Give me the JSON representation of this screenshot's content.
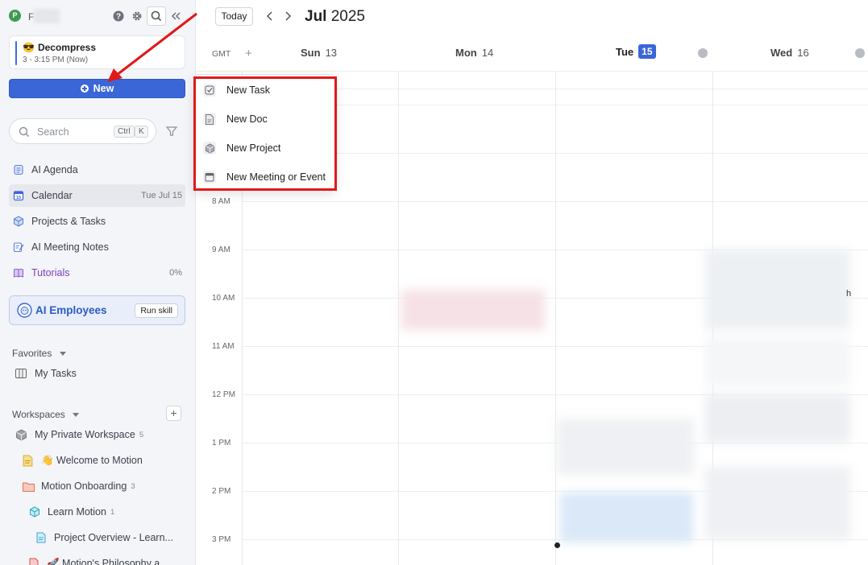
{
  "sidebar": {
    "workspace_initial": "P",
    "workspace_name": "F",
    "current_event": {
      "emoji": "😎",
      "title": "Decompress",
      "time": "3 - 3:15 PM (Now)"
    },
    "new_button_label": "New",
    "search": {
      "placeholder": "Search",
      "kbd1": "Ctrl",
      "kbd2": "K"
    },
    "nav": [
      {
        "label": "AI Agenda",
        "meta": "",
        "icon": "document-stack-icon"
      },
      {
        "label": "Calendar",
        "meta": "Tue Jul 15",
        "icon": "calendar-icon"
      },
      {
        "label": "Projects & Tasks",
        "meta": "",
        "icon": "cube-icon"
      },
      {
        "label": "AI Meeting Notes",
        "meta": "",
        "icon": "notes-icon"
      },
      {
        "label": "Tutorials",
        "meta": "0%",
        "icon": "book-icon"
      }
    ],
    "ai_employees": {
      "label": "AI Employees",
      "run_skill": "Run skill"
    },
    "favorites": {
      "heading": "Favorites",
      "items": [
        {
          "label": "My Tasks"
        }
      ]
    },
    "workspaces": {
      "heading": "Workspaces",
      "items": [
        {
          "label": "My Private Workspace",
          "count": "5"
        },
        {
          "label": "👋 Welcome to Motion",
          "count": ""
        },
        {
          "label": "Motion Onboarding",
          "count": "3"
        },
        {
          "label": "Learn Motion",
          "count": "1"
        },
        {
          "label": "Project Overview - Learn...",
          "count": ""
        },
        {
          "label": "🚀 Motion's Philosophy a...",
          "count": ""
        }
      ]
    }
  },
  "calendar": {
    "today_label": "Today",
    "month": "Jul",
    "year": "2025",
    "timezone": "GMT",
    "days": [
      {
        "name": "Sun",
        "num": "13"
      },
      {
        "name": "Mon",
        "num": "14"
      },
      {
        "name": "Tue",
        "num": "15"
      },
      {
        "name": "Wed",
        "num": "16"
      }
    ],
    "times": [
      "8 AM",
      "9 AM",
      "10 AM",
      "11 AM",
      "12 PM",
      "1 PM",
      "2 PM",
      "3 PM"
    ],
    "partial_text": "h"
  },
  "new_menu": {
    "items": [
      {
        "label": "New Task",
        "icon": "task-check-icon"
      },
      {
        "label": "New Doc",
        "icon": "doc-icon"
      },
      {
        "label": "New Project",
        "icon": "cube-icon"
      },
      {
        "label": "New Meeting or Event",
        "icon": "calendar-icon"
      }
    ]
  },
  "colors": {
    "accent": "#3b66d8",
    "annotation": "#e01919"
  }
}
